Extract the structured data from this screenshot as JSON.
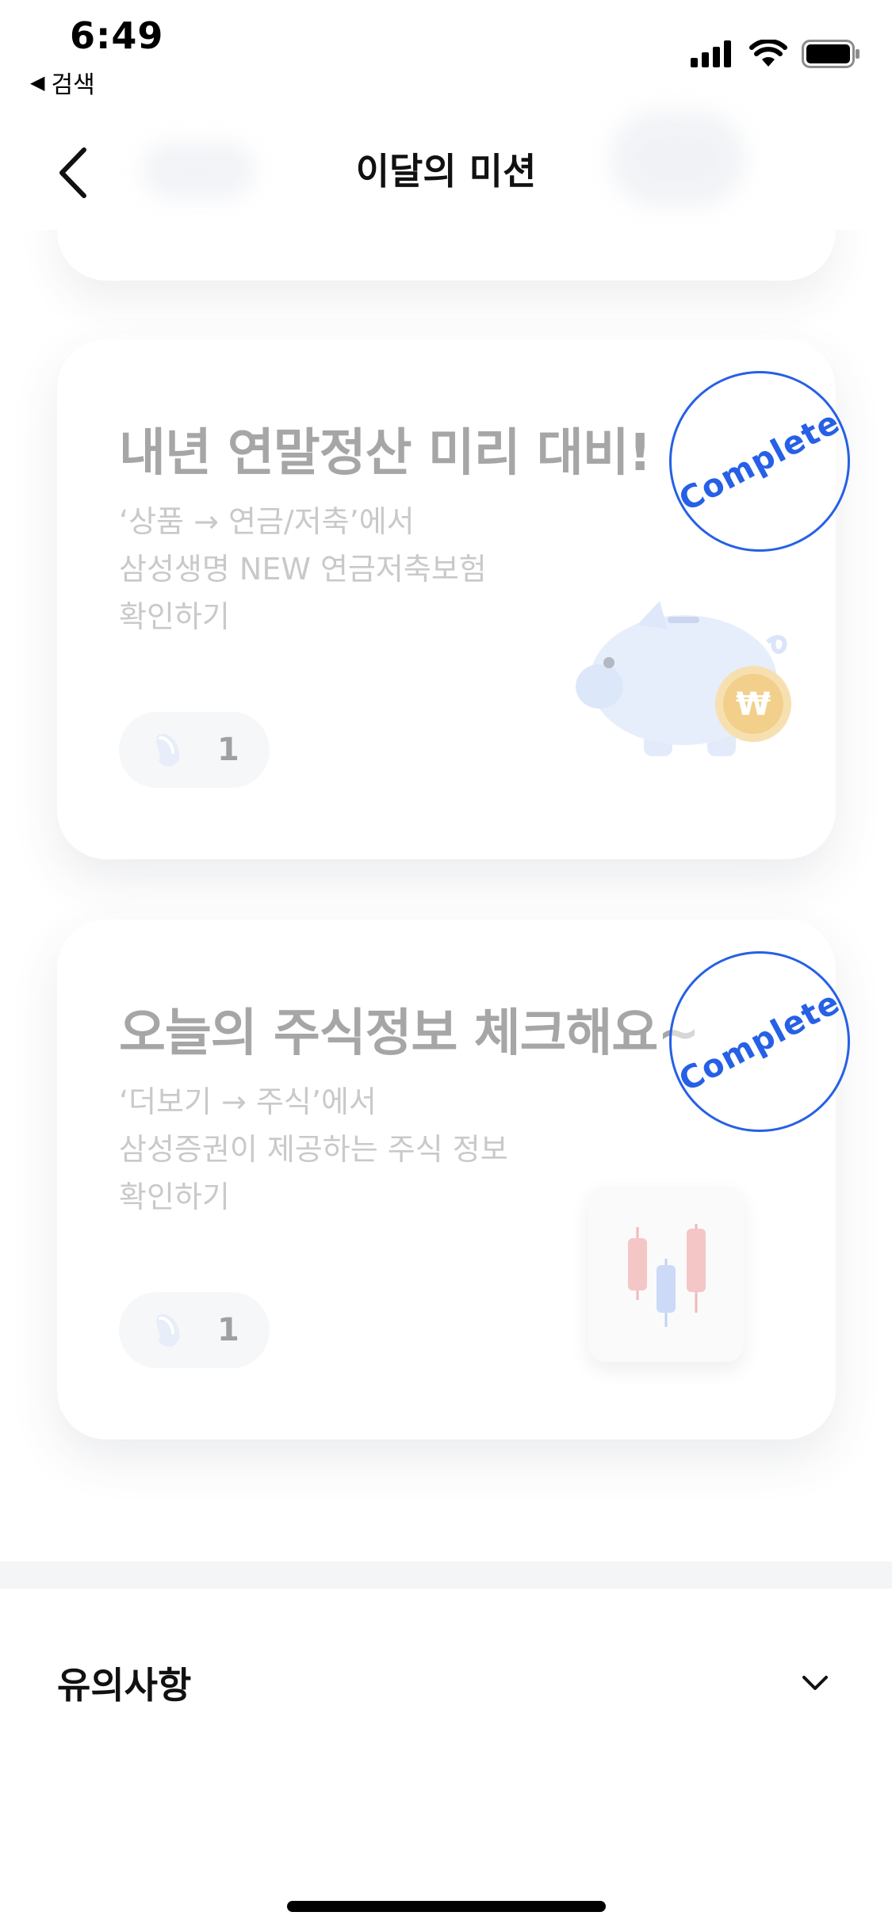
{
  "status_bar": {
    "time": "6:49",
    "back_app_label": "검색"
  },
  "nav": {
    "title": "이달의 미션",
    "back_icon": "chevron-left-icon"
  },
  "missions": [
    {
      "title": "내년 연말정산 미리 대비!",
      "desc_lines": [
        "‘상품 → 연금/저축’에서",
        "삼성생명 NEW 연금저축보험",
        "확인하기"
      ],
      "reward_count": "1",
      "stamp_label": "Complete",
      "illustration": "piggy-bank-coin-icon"
    },
    {
      "title": "오늘의 주식정보 체크해요~",
      "desc_lines": [
        "‘더보기 → 주식’에서",
        "삼성증권이 제공하는 주식 정보",
        "확인하기"
      ],
      "reward_count": "1",
      "stamp_label": "Complete",
      "illustration": "candlestick-chart-icon"
    }
  ],
  "notice": {
    "title": "유의사항",
    "toggle_icon": "chevron-down-icon"
  },
  "colors": {
    "stamp_blue": "#2660e6",
    "title_gray": "#a6a6a6",
    "desc_gray": "#c9c9c9"
  }
}
